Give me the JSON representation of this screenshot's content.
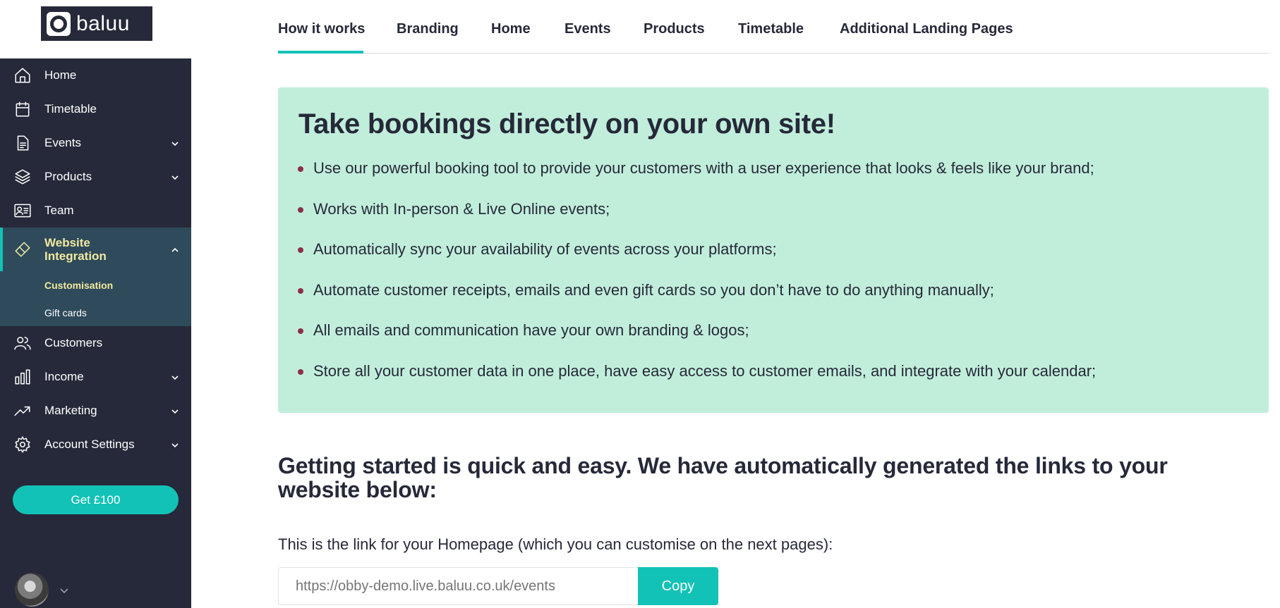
{
  "logo": {
    "text": "baluu"
  },
  "sidebar": {
    "items": [
      {
        "label": "Home",
        "icon": "home-icon"
      },
      {
        "label": "Timetable",
        "icon": "calendar-icon"
      },
      {
        "label": "Events",
        "icon": "document-icon",
        "expandable": true
      },
      {
        "label": "Products",
        "icon": "layers-icon",
        "expandable": true
      },
      {
        "label": "Team",
        "icon": "team-icon"
      },
      {
        "label": "Website Integration",
        "icon": "tag-icon",
        "expandable": true,
        "expanded": true,
        "active": true
      },
      {
        "label": "Customers",
        "icon": "users-icon"
      },
      {
        "label": "Income",
        "icon": "bar-chart-icon",
        "expandable": true
      },
      {
        "label": "Marketing",
        "icon": "trend-icon",
        "expandable": true
      },
      {
        "label": "Account Settings",
        "icon": "gear-icon",
        "expandable": true
      }
    ],
    "subitems": [
      {
        "label": "Customisation",
        "active": true
      },
      {
        "label": "Gift cards"
      }
    ],
    "cta": "Get £100"
  },
  "tabs": [
    {
      "label": "How it works",
      "active": true
    },
    {
      "label": "Branding"
    },
    {
      "label": "Home"
    },
    {
      "label": "Events"
    },
    {
      "label": "Products"
    },
    {
      "label": "Timetable"
    },
    {
      "label": "Additional Landing Pages"
    }
  ],
  "promo": {
    "title": "Take bookings directly on your own site!",
    "bullets": [
      "Use our powerful booking tool to provide your customers with a user experience that looks & feels like your brand;",
      "Works with In-person & Live Online events;",
      "Automatically sync your availability of events across your platforms;",
      "Automate customer receipts, emails and even gift cards so you don’t have to do anything manually;",
      "All emails and communication have your own branding & logos;",
      "Store all your customer data in one place, have easy access to customer emails, and integrate with your calendar;"
    ]
  },
  "getting_started": {
    "heading": "Getting started is quick and easy. We have automatically generated the links to your website below:",
    "homepage_text": "This is the link for your Homepage (which you can customise on the next pages):",
    "url_placeholder": "https://obby-demo.live.baluu.co.uk/events",
    "copy_label": "Copy"
  },
  "colors": {
    "sidebar": "#262939",
    "accent": "#12c2b6",
    "promo_bg": "#c1eedb",
    "active_text": "#f3eaa0",
    "bullet": "#8c2f4a"
  }
}
